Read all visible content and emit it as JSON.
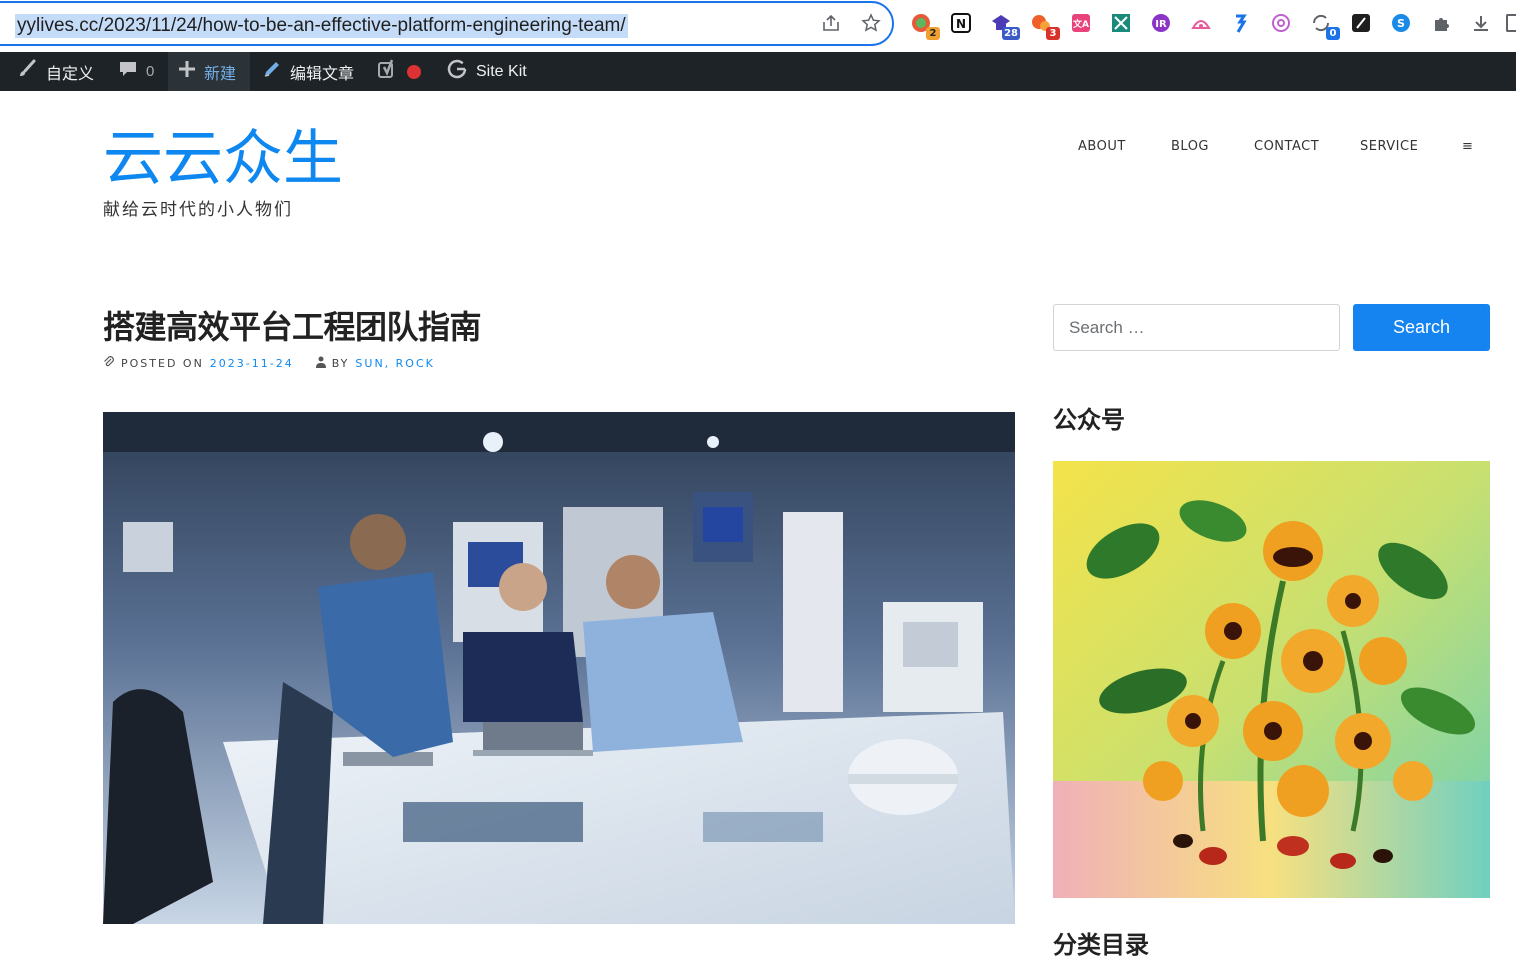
{
  "browser": {
    "url": "yylives.cc/2023/11/24/how-to-be-an-effective-platform-engineering-team/",
    "extension_badges": {
      "ext1": "2",
      "ext4": "28",
      "ext5": "3",
      "ext13": "0"
    }
  },
  "admin_bar": {
    "customize": "自定义",
    "comments_count": "0",
    "new": "新建",
    "edit_post": "编辑文章",
    "site_kit": "Site Kit"
  },
  "site": {
    "title": "云云众生",
    "tagline": "献给云时代的小人物们"
  },
  "nav": {
    "items": [
      "ABOUT",
      "BLOG",
      "CONTACT",
      "SERVICE"
    ],
    "menu_toggle": "≡"
  },
  "post": {
    "title": "搭建高效平台工程团队指南",
    "posted_on_label": "POSTED ON",
    "date": "2023-11-24",
    "by_label": "BY",
    "authors": "SUN, ROCK"
  },
  "sidebar": {
    "search_placeholder": "Search …",
    "search_button": "Search",
    "widget_wechat_title": "公众号",
    "widget_categories_title": "分类目录"
  },
  "colors": {
    "accent": "#0e88f0",
    "search_button": "#1583f0",
    "admin_bar": "#1d2327",
    "url_highlight": "#c5dcf8"
  },
  "icons": [
    "lock-icon",
    "share-icon",
    "star-icon",
    "puzzle-icon",
    "download-icon",
    "brush-icon",
    "comment-icon",
    "plus-icon",
    "pencil-icon",
    "yoast-icon",
    "google-icon",
    "paperclip-icon",
    "user-icon"
  ]
}
